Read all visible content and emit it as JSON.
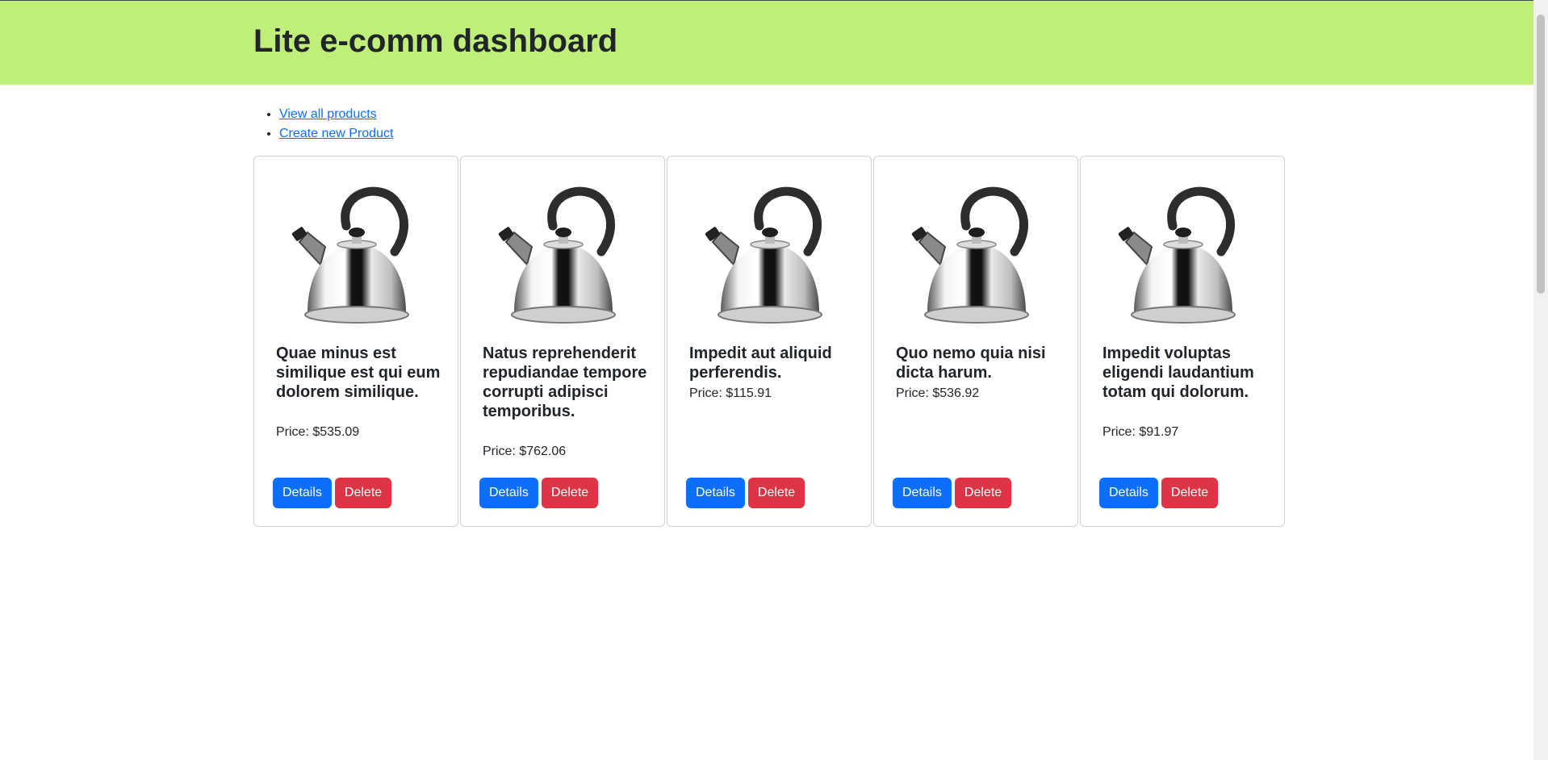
{
  "header": {
    "title": "Lite e-comm dashboard"
  },
  "nav": {
    "links": [
      "View all products",
      "Create new Product"
    ]
  },
  "products": [
    {
      "title": "Quae minus est similique est qui eum dolorem similique.",
      "price": "Price: $535.09"
    },
    {
      "title": "Natus reprehenderit repudiandae tempore corrupti adipisci temporibus.",
      "price": "Price: $762.06"
    },
    {
      "title": "Impedit aut aliquid perferendis.",
      "price": "Price: $115.91"
    },
    {
      "title": "Quo nemo quia nisi dicta harum.",
      "price": "Price: $536.92"
    },
    {
      "title": "Impedit voluptas eligendi laudantium totam qui dolorum.",
      "price": "Price: $91.97"
    }
  ],
  "buttons": {
    "details": "Details",
    "delete": "Delete"
  },
  "colors": {
    "header_bg": "#bfee7a",
    "primary": "#0d6efd",
    "danger": "#dc3545",
    "link": "#0d6efd"
  },
  "icons": {
    "product_image": "kettle-image"
  }
}
